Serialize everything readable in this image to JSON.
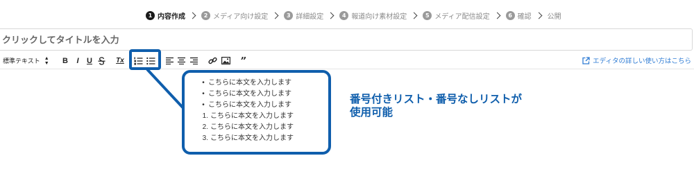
{
  "stepper": {
    "steps": [
      {
        "num": "1",
        "label": "内容作成",
        "active": true
      },
      {
        "num": "2",
        "label": "メディア向け設定"
      },
      {
        "num": "3",
        "label": "詳細設定"
      },
      {
        "num": "4",
        "label": "報道向け素材設定"
      },
      {
        "num": "5",
        "label": "メディア配信設定"
      },
      {
        "num": "6",
        "label": "確認"
      }
    ],
    "final_label": "公開"
  },
  "title_input": {
    "placeholder": "クリックしてタイトルを入力",
    "value": ""
  },
  "toolbar": {
    "format_select": "標準テキスト",
    "bold": "B",
    "italic": "I",
    "underline": "U",
    "clear_format": "Tx",
    "quote": "”",
    "help_link": "エディタの詳しい使い方はこちら"
  },
  "callout": {
    "bullet_items": [
      "こちらに本文を入力します",
      "こちらに本文を入力します",
      "こちらに本文を入力します"
    ],
    "numbered_items": [
      {
        "n": "1.",
        "text": "こちらに本文を入力します"
      },
      {
        "n": "2.",
        "text": "こちらに本文を入力します"
      },
      {
        "n": "3.",
        "text": "こちらに本文を入力します"
      }
    ]
  },
  "feature_text": {
    "line1": "番号付きリスト・番号なしリストが",
    "line2": "使用可能"
  },
  "colors": {
    "accent": "#0f5eac",
    "link": "#2d7bd4",
    "step_active": "#1a1a1a",
    "step_inactive": "#9a9a9a"
  }
}
